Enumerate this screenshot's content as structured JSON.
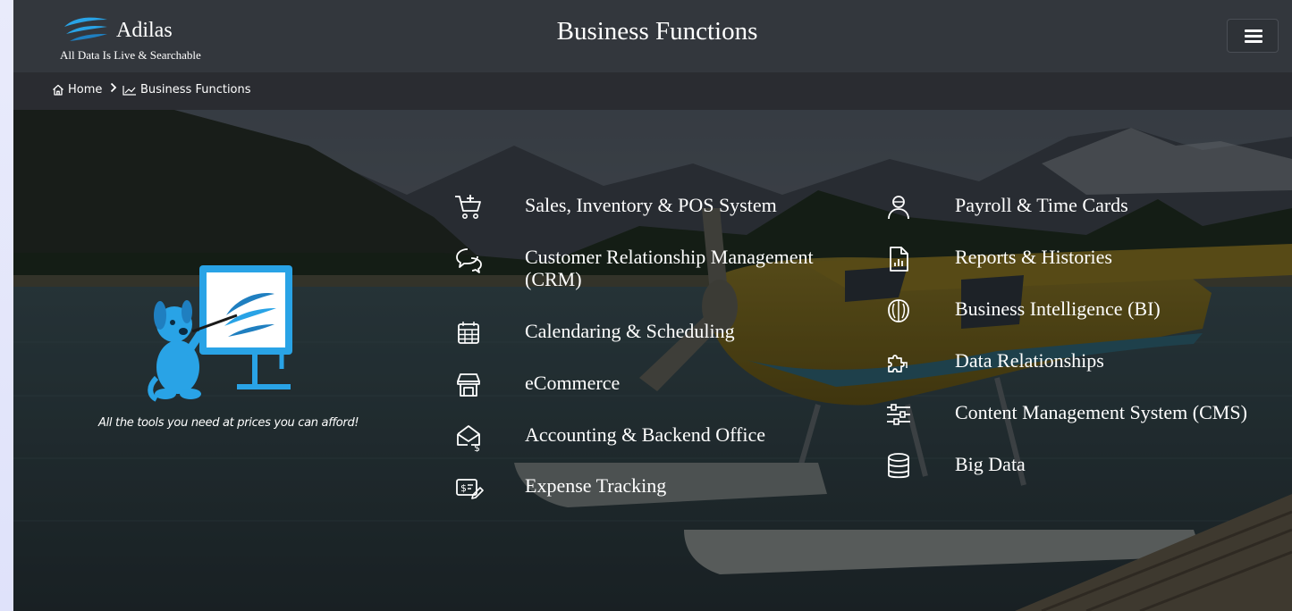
{
  "header": {
    "brand_name": "Adilas",
    "brand_tagline": "All Data Is Live & Searchable",
    "title": "Business Functions",
    "menu_icon": "hamburger-icon"
  },
  "breadcrumb": {
    "home_label": "Home",
    "separator": ">",
    "current_label": "Business Functions"
  },
  "hero": {
    "tagline": "All the tools you need at prices you can afford!",
    "left_functions": [
      {
        "label": "Sales, Inventory & POS System",
        "icon": "cart-plus-icon"
      },
      {
        "label": "Customer Relationship Management",
        "label2": "(CRM)",
        "icon": "chat-bubbles-icon"
      },
      {
        "label": "Calendaring & Scheduling",
        "icon": "calendar-icon"
      },
      {
        "label": "eCommerce",
        "icon": "storefront-icon"
      },
      {
        "label": "Accounting & Backend Office",
        "icon": "envelope-dollar-icon"
      },
      {
        "label": "Expense Tracking",
        "icon": "receipt-pencil-icon"
      }
    ],
    "right_functions": [
      {
        "label": "Payroll & Time Cards",
        "icon": "user-icon"
      },
      {
        "label": "Reports & Histories",
        "icon": "report-file-icon"
      },
      {
        "label": "Business Intelligence (BI)",
        "icon": "brain-icon"
      },
      {
        "label": "Data Relationships",
        "icon": "puzzle-icon"
      },
      {
        "label": "Content Management System (CMS)",
        "icon": "sliders-icon"
      },
      {
        "label": "Big Data",
        "icon": "database-icon"
      }
    ]
  },
  "colors": {
    "header_bg": "#33373d",
    "breadcrumb_bg": "#2a2c31",
    "brand_blue": "#29a3e6",
    "text": "#ffffff"
  }
}
